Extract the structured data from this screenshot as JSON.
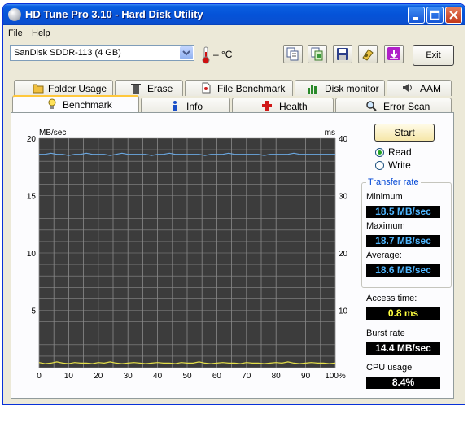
{
  "window": {
    "title": "HD Tune Pro 3.10 - Hard Disk Utility"
  },
  "menu": {
    "file": "File",
    "help": "Help"
  },
  "toolbar": {
    "drive": "SanDisk SDDR-113 (4 GB)",
    "temperature": "– °C",
    "exit_label": "Exit",
    "icons": [
      "copy-text-icon",
      "copy-screenshot-icon",
      "save-icon",
      "options-icon",
      "download-icon"
    ]
  },
  "tabs_top": [
    "Folder Usage",
    "Erase",
    "File Benchmark",
    "Disk monitor",
    "AAM"
  ],
  "tabs_bottom": [
    "Benchmark",
    "Info",
    "Health",
    "Error Scan"
  ],
  "active_tab": "Benchmark",
  "controls": {
    "start_label": "Start",
    "read_label": "Read",
    "write_label": "Write",
    "selected_mode": "Read"
  },
  "stats": {
    "transfer_rate_title": "Transfer rate",
    "minimum_label": "Minimum",
    "minimum_value": "18.5 MB/sec",
    "maximum_label": "Maximum",
    "maximum_value": "18.7 MB/sec",
    "average_label": "Average:",
    "average_value": "18.6 MB/sec",
    "access_time_label": "Access time:",
    "access_time_value": "0.8 ms",
    "burst_rate_label": "Burst rate",
    "burst_rate_value": "14.4 MB/sec",
    "cpu_usage_label": "CPU usage",
    "cpu_usage_value": "8.4%"
  },
  "colors": {
    "read_line": "#6aa7e0",
    "access_line": "#e5e04a",
    "plot_bg": "#3c3c3c",
    "grid": "#8a8a8a"
  },
  "chart_data": {
    "type": "line",
    "ylabel_left": "MB/sec",
    "ylabel_right": "ms",
    "x_ticks": [
      "0",
      "10",
      "20",
      "30",
      "40",
      "50",
      "60",
      "70",
      "80",
      "90",
      "100%"
    ],
    "y_ticks_left": [
      "20",
      "15",
      "10",
      "5"
    ],
    "y_ticks_right": [
      "40",
      "30",
      "20",
      "10"
    ],
    "xlim": [
      0,
      100
    ],
    "ylim_left": [
      0,
      20
    ],
    "ylim_right": [
      0,
      40
    ],
    "grid": true,
    "series": [
      {
        "x": [
          0,
          2,
          4,
          6,
          8,
          10,
          12,
          14,
          16,
          18,
          20,
          22,
          24,
          26,
          28,
          30,
          32,
          34,
          36,
          38,
          40,
          42,
          44,
          46,
          48,
          50,
          52,
          54,
          56,
          58,
          60,
          62,
          64,
          66,
          68,
          70,
          72,
          74,
          76,
          78,
          80,
          82,
          84,
          86,
          88,
          90,
          92,
          94,
          96,
          98,
          100
        ],
        "values": [
          18.6,
          18.6,
          18.7,
          18.6,
          18.6,
          18.5,
          18.6,
          18.6,
          18.7,
          18.6,
          18.6,
          18.6,
          18.5,
          18.6,
          18.7,
          18.6,
          18.6,
          18.6,
          18.6,
          18.5,
          18.6,
          18.6,
          18.7,
          18.6,
          18.6,
          18.6,
          18.6,
          18.6,
          18.5,
          18.6,
          18.6,
          18.6,
          18.7,
          18.6,
          18.6,
          18.6,
          18.6,
          18.6,
          18.5,
          18.6,
          18.6,
          18.6,
          18.6,
          18.7,
          18.6,
          18.6,
          18.6,
          18.6,
          18.6,
          18.6,
          18.6
        ]
      },
      {
        "axis": "right",
        "x": [
          0,
          2,
          4,
          6,
          8,
          10,
          12,
          14,
          16,
          18,
          20,
          22,
          24,
          26,
          28,
          30,
          32,
          34,
          36,
          38,
          40,
          42,
          44,
          46,
          48,
          50,
          52,
          54,
          56,
          58,
          60,
          62,
          64,
          66,
          68,
          70,
          72,
          74,
          76,
          78,
          80,
          82,
          84,
          86,
          88,
          90,
          92,
          94,
          96,
          98,
          100
        ],
        "values": [
          0.9,
          0.7,
          0.8,
          1.0,
          0.8,
          0.7,
          0.9,
          0.8,
          0.8,
          0.7,
          0.9,
          0.8,
          1.0,
          0.8,
          0.7,
          0.8,
          0.9,
          0.8,
          0.7,
          0.8,
          0.9,
          0.8,
          0.8,
          0.7,
          0.9,
          0.8,
          0.8,
          1.0,
          0.8,
          0.7,
          0.8,
          0.9,
          0.8,
          0.8,
          0.7,
          0.9,
          0.8,
          0.8,
          0.7,
          0.8,
          0.9,
          0.8,
          1.0,
          0.8,
          0.7,
          0.8,
          0.9,
          0.8,
          0.8,
          0.7,
          0.8
        ]
      }
    ]
  }
}
